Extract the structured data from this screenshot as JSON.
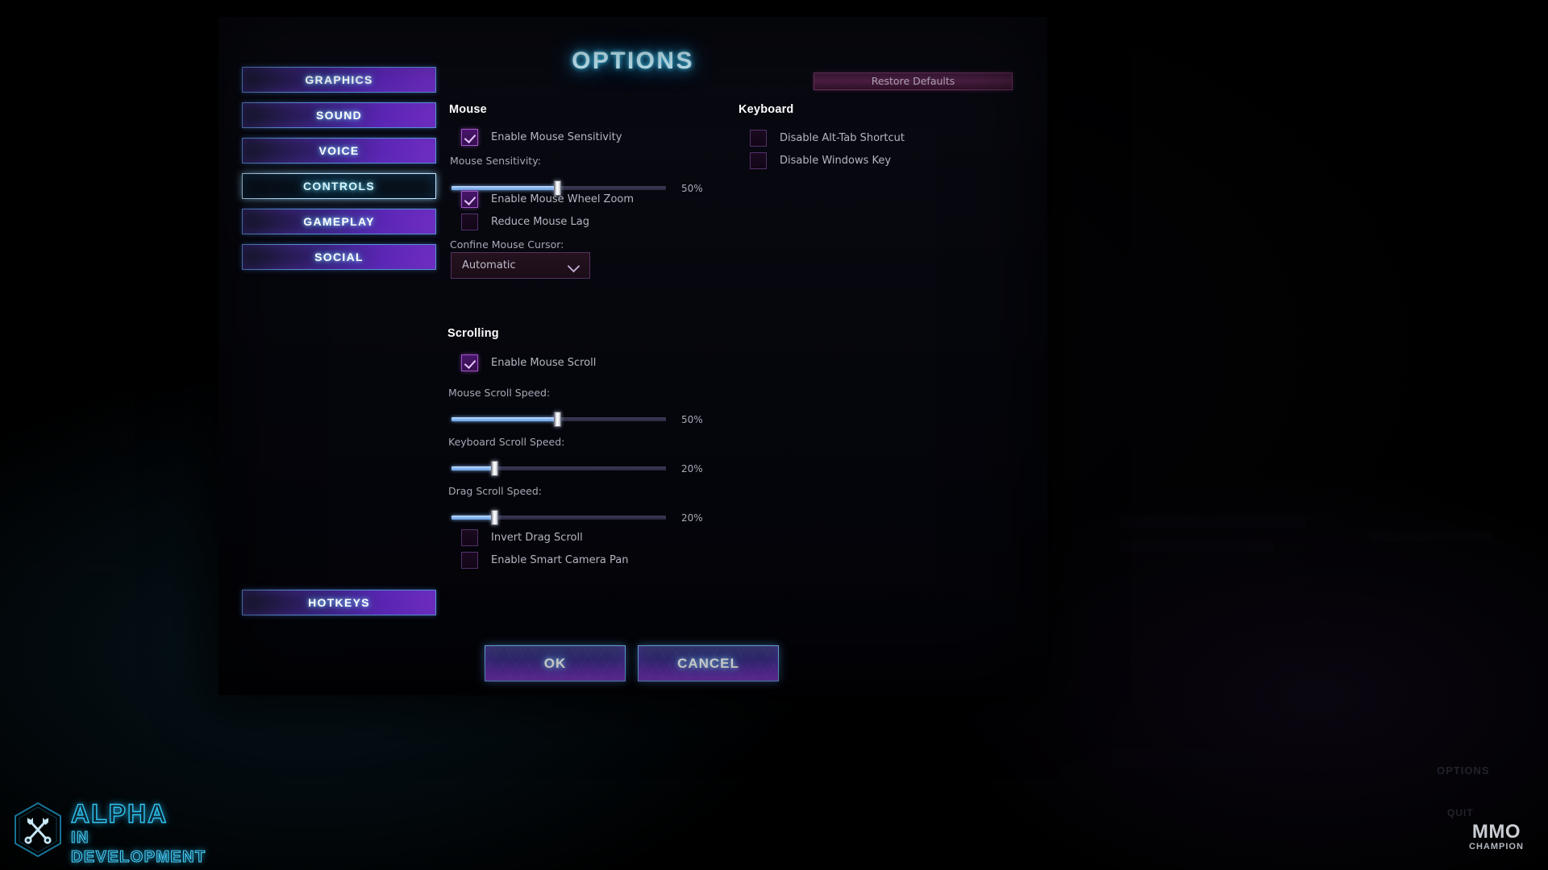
{
  "title": "OPTIONS",
  "nav": {
    "items": [
      {
        "label": "GRAPHICS",
        "active": false
      },
      {
        "label": "SOUND",
        "active": false
      },
      {
        "label": "VOICE",
        "active": false
      },
      {
        "label": "CONTROLS",
        "active": true
      },
      {
        "label": "GAMEPLAY",
        "active": false
      },
      {
        "label": "SOCIAL",
        "active": false
      }
    ],
    "hotkeys_label": "HOTKEYS"
  },
  "restore_defaults_label": "Restore Defaults",
  "mouse": {
    "heading": "Mouse",
    "enable_sensitivity": {
      "label": "Enable Mouse Sensitivity",
      "checked": true
    },
    "sensitivity": {
      "label": "Mouse Sensitivity:",
      "value": 50,
      "display": "50%"
    },
    "enable_wheel_zoom": {
      "label": "Enable Mouse Wheel Zoom",
      "checked": true
    },
    "reduce_lag": {
      "label": "Reduce Mouse Lag",
      "checked": false
    },
    "confine_cursor": {
      "label": "Confine Mouse Cursor:",
      "value": "Automatic"
    }
  },
  "keyboard": {
    "heading": "Keyboard",
    "disable_alt_tab": {
      "label": "Disable Alt-Tab Shortcut",
      "checked": false
    },
    "disable_windows_key": {
      "label": "Disable Windows Key",
      "checked": false
    }
  },
  "scrolling": {
    "heading": "Scrolling",
    "enable_mouse_scroll": {
      "label": "Enable Mouse Scroll",
      "checked": true
    },
    "mouse_scroll_speed": {
      "label": "Mouse Scroll Speed:",
      "value": 50,
      "display": "50%"
    },
    "keyboard_scroll_speed": {
      "label": "Keyboard Scroll Speed:",
      "value": 20,
      "display": "20%"
    },
    "drag_scroll_speed": {
      "label": "Drag Scroll Speed:",
      "value": 20,
      "display": "20%"
    },
    "invert_drag_scroll": {
      "label": "Invert Drag Scroll",
      "checked": false
    },
    "enable_smart_camera_pan": {
      "label": "Enable Smart Camera Pan",
      "checked": false
    }
  },
  "footer": {
    "ok_label": "OK",
    "cancel_label": "CANCEL"
  },
  "watermark": {
    "line1": "ALPHA",
    "line2": "IN DEVELOPMENT",
    "logo_top": "MMO",
    "logo_bottom": "CHAMPION"
  },
  "ghost": {
    "options": "OPTIONS",
    "quit": "QUIT"
  },
  "colors": {
    "accent_blue": "#49d8ff",
    "nav_purple": "#6b34b6",
    "slider_fill": "#8bb9f2",
    "checkbox_on": "#a354c9",
    "restore_magenta": "#4e2045"
  }
}
